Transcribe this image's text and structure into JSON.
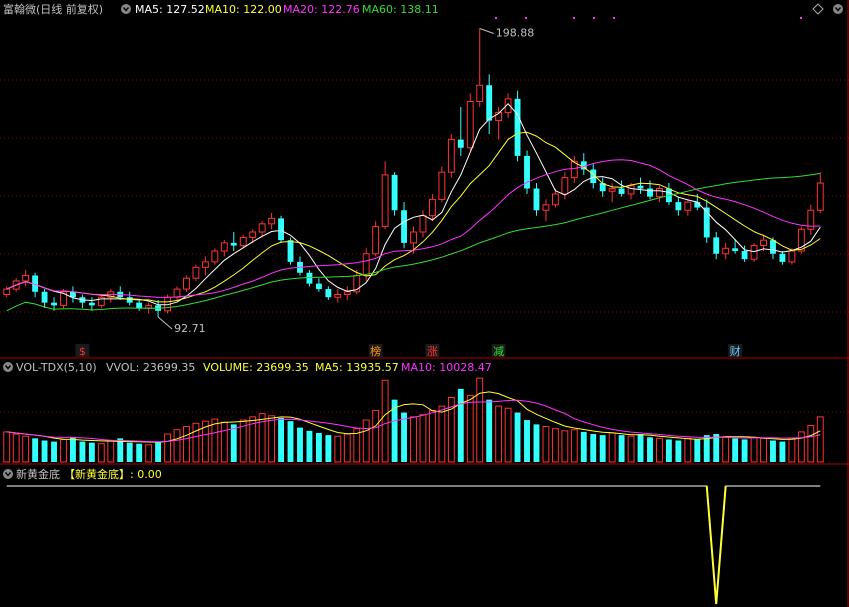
{
  "header": {
    "title": "富翰微(日线 前复权)",
    "ma": [
      {
        "label": "MA5: 127.52",
        "color": "#ffffff"
      },
      {
        "label": "MA10: 122.00",
        "color": "#ffff33"
      },
      {
        "label": "MA20: 122.76",
        "color": "#ff33ff"
      },
      {
        "label": "MA60: 138.11",
        "color": "#33dd33"
      }
    ]
  },
  "vol_header": {
    "name": "VOL-TDX(5,10)",
    "vvol": "VVOL: 23699.35",
    "volume": "VOLUME: 23699.35",
    "ma5": "MA5: 13935.57",
    "ma10": "MA10: 10028.47"
  },
  "ind_header": {
    "name": "新黄金底",
    "label": "【新黄金底】: 0.00"
  },
  "colors": {
    "up": "#ff3333",
    "down": "#33ffff",
    "ma5": "#ffffff",
    "ma10": "#ffff33",
    "ma20": "#ff33ff",
    "ma60": "#33dd33",
    "grid": "#8b0000",
    "text": "#c0c0c0"
  },
  "event_tags": [
    {
      "text": "$",
      "color": "#ff3333",
      "index": 8
    },
    {
      "text": "榜",
      "color": "#ff9900",
      "index": 39
    },
    {
      "text": "涨",
      "color": "#ff3333",
      "index": 45
    },
    {
      "text": "减",
      "color": "#33dd33",
      "index": 52
    },
    {
      "text": "财",
      "color": "#66ccff",
      "index": 77
    }
  ],
  "chart_data": [
    {
      "type": "candlestick",
      "title": "富翰微(日线 前复权)",
      "annotations": [
        {
          "text": "198.88",
          "index": 50,
          "value": 198.88
        },
        {
          "text": "92.71",
          "index": 16,
          "value": 92.71
        }
      ],
      "ohlc": [
        [
          101,
          104,
          100,
          103
        ],
        [
          103,
          107,
          102,
          106
        ],
        [
          106,
          110,
          104,
          108
        ],
        [
          108,
          109,
          100,
          102
        ],
        [
          102,
          103,
          96,
          98
        ],
        [
          98,
          100,
          95,
          97
        ],
        [
          97,
          103,
          96,
          102
        ],
        [
          102,
          104,
          98,
          100
        ],
        [
          100,
          101,
          96,
          98
        ],
        [
          98,
          100,
          95,
          97
        ],
        [
          97,
          101,
          96,
          100
        ],
        [
          100,
          103,
          98,
          102
        ],
        [
          102,
          104,
          99,
          100
        ],
        [
          100,
          102,
          97,
          98
        ],
        [
          98,
          99,
          95,
          96
        ],
        [
          96,
          98,
          94,
          97
        ],
        [
          97,
          99,
          92.71,
          95
        ],
        [
          95,
          101,
          94,
          100
        ],
        [
          100,
          104,
          99,
          103
        ],
        [
          103,
          108,
          102,
          107
        ],
        [
          107,
          112,
          106,
          111
        ],
        [
          111,
          115,
          108,
          113
        ],
        [
          113,
          118,
          112,
          117
        ],
        [
          117,
          121,
          115,
          120
        ],
        [
          120,
          124,
          117,
          119
        ],
        [
          119,
          123,
          118,
          122
        ],
        [
          122,
          125,
          120,
          124
        ],
        [
          124,
          128,
          122,
          127
        ],
        [
          127,
          131,
          125,
          129
        ],
        [
          129,
          130,
          120,
          121
        ],
        [
          121,
          122,
          112,
          113
        ],
        [
          113,
          115,
          108,
          109
        ],
        [
          109,
          110,
          104,
          105
        ],
        [
          105,
          107,
          102,
          103
        ],
        [
          103,
          104,
          99,
          100
        ],
        [
          100,
          103,
          98,
          101
        ],
        [
          101,
          104,
          99,
          102
        ],
        [
          102,
          110,
          101,
          108
        ],
        [
          108,
          118,
          106,
          116
        ],
        [
          116,
          128,
          115,
          126
        ],
        [
          126,
          150,
          125,
          145
        ],
        [
          145,
          146,
          130,
          132
        ],
        [
          132,
          135,
          118,
          120
        ],
        [
          120,
          126,
          116,
          124
        ],
        [
          124,
          132,
          122,
          130
        ],
        [
          130,
          138,
          128,
          136
        ],
        [
          136,
          148,
          135,
          146
        ],
        [
          146,
          160,
          144,
          158
        ],
        [
          158,
          170,
          152,
          155
        ],
        [
          155,
          175,
          154,
          172
        ],
        [
          172,
          198.88,
          170,
          178
        ],
        [
          178,
          182,
          160,
          165
        ],
        [
          165,
          170,
          158,
          168
        ],
        [
          168,
          175,
          166,
          173
        ],
        [
          173,
          176,
          150,
          152
        ],
        [
          152,
          154,
          138,
          140
        ],
        [
          140,
          142,
          130,
          132
        ],
        [
          132,
          136,
          128,
          134
        ],
        [
          134,
          140,
          133,
          138
        ],
        [
          138,
          146,
          136,
          144
        ],
        [
          144,
          152,
          142,
          150
        ],
        [
          150,
          153,
          145,
          147
        ],
        [
          147,
          149,
          140,
          142
        ],
        [
          142,
          144,
          137,
          139
        ],
        [
          139,
          142,
          135,
          140
        ],
        [
          140,
          143,
          137,
          138
        ],
        [
          138,
          142,
          136,
          141
        ],
        [
          141,
          144,
          138,
          140
        ],
        [
          140,
          143,
          136,
          137
        ],
        [
          137,
          141,
          135,
          140
        ],
        [
          140,
          142,
          134,
          135
        ],
        [
          135,
          137,
          130,
          132
        ],
        [
          132,
          136,
          130,
          135
        ],
        [
          135,
          138,
          132,
          133
        ],
        [
          133,
          136,
          120,
          122
        ],
        [
          122,
          124,
          114,
          116
        ],
        [
          116,
          120,
          114,
          118
        ],
        [
          118,
          121,
          116,
          117
        ],
        [
          117,
          119,
          113,
          114
        ],
        [
          114,
          120,
          113,
          119
        ],
        [
          119,
          123,
          117,
          121
        ],
        [
          121,
          122,
          114,
          116
        ],
        [
          116,
          117,
          112,
          113
        ],
        [
          113,
          118,
          112,
          117
        ],
        [
          117,
          126,
          116,
          125
        ],
        [
          125,
          134,
          123,
          132
        ],
        [
          132,
          146,
          131,
          142
        ]
      ]
    },
    {
      "type": "bar",
      "title": "VOL-TDX(5,10)",
      "values": [
        2800,
        2600,
        2400,
        2200,
        2000,
        1900,
        2100,
        2300,
        1900,
        1800,
        1700,
        2000,
        2200,
        1800,
        1700,
        1600,
        1900,
        2600,
        3000,
        3300,
        3600,
        3800,
        4000,
        3700,
        3500,
        3900,
        4200,
        4500,
        4300,
        4100,
        3800,
        3200,
        2900,
        2700,
        2500,
        2400,
        2600,
        3100,
        3900,
        4800,
        7600,
        5800,
        4600,
        4200,
        4400,
        4800,
        5200,
        6000,
        6800,
        6200,
        7800,
        5800,
        5200,
        5000,
        4600,
        3900,
        3500,
        3300,
        3100,
        2900,
        3000,
        2800,
        2600,
        2500,
        2700,
        2500,
        2400,
        2600,
        2300,
        2200,
        2100,
        2000,
        2200,
        2100,
        2500,
        2600,
        2300,
        2200,
        2100,
        2300,
        2200,
        2000,
        1900,
        2200,
        2800,
        3400,
        4200
      ]
    },
    {
      "type": "line",
      "title": "新黄金底",
      "values": [
        0,
        0,
        0,
        0,
        0,
        0,
        0,
        0,
        0,
        0,
        0,
        0,
        0,
        0,
        0,
        0,
        0,
        0,
        0,
        0,
        0,
        0,
        0,
        0,
        0,
        0,
        0,
        0,
        0,
        0,
        0,
        0,
        0,
        0,
        0,
        0,
        0,
        0,
        0,
        0,
        0,
        0,
        0,
        0,
        0,
        0,
        0,
        0,
        0,
        0,
        0,
        0,
        0,
        0,
        0,
        0,
        0,
        0,
        0,
        0,
        0,
        0,
        0,
        0,
        0,
        0,
        0,
        0,
        0,
        0,
        0,
        0,
        0,
        0,
        0,
        -1,
        0,
        0,
        0,
        0,
        0,
        0,
        0,
        0,
        0,
        0,
        0
      ]
    }
  ]
}
